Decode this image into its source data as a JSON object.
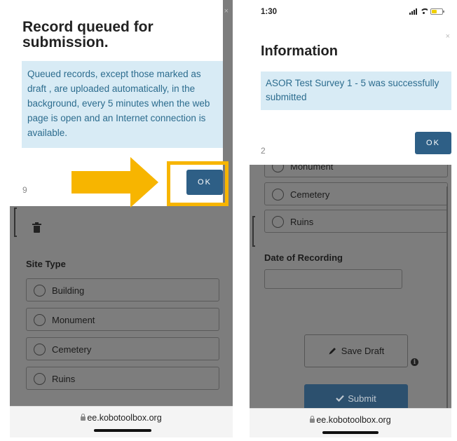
{
  "left": {
    "dialog": {
      "title": "Record queued for submission.",
      "message": "Queued records, except those marked as draft , are uploaded automatically, in the background, every 5 minutes when the web page is open and an Internet connection is available.",
      "countdown": "9",
      "ok_label": "OK",
      "close": "×"
    },
    "form": {
      "section_label": "Site Type",
      "options": [
        "Building",
        "Monument",
        "Cemetery",
        "Ruins"
      ]
    },
    "url": "ee.kobotoolbox.org"
  },
  "right": {
    "status": {
      "time": "1:30"
    },
    "dialog": {
      "title": "Information",
      "message": "ASOR Test Survey 1 - 5 was successfully submitted",
      "countdown": "2",
      "ok_label": "OK",
      "close": "×"
    },
    "form": {
      "partial_option": "Monument",
      "options": [
        "Cemetery",
        "Ruins"
      ],
      "date_label": "Date of Recording",
      "date_value": "",
      "save_draft_label": "Save Draft",
      "submit_label": "Submit"
    },
    "url": "ee.kobotoolbox.org"
  },
  "colors": {
    "ok_button": "#2e5f86",
    "message_bg": "#d8ebf5",
    "message_text": "#2c6c8e",
    "annotation": "#f7b500"
  },
  "icons": [
    "trash-icon",
    "pencil-icon",
    "checkmark-icon",
    "info-icon",
    "lock-icon",
    "arrow-right-icon",
    "signal-icon",
    "wifi-icon",
    "battery-icon"
  ]
}
